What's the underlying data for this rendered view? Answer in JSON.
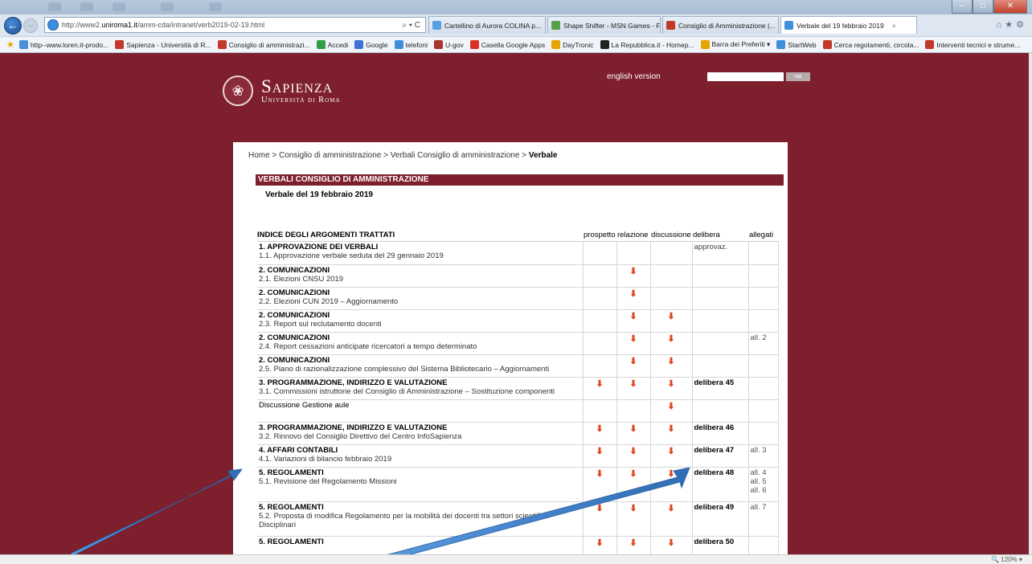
{
  "browser": {
    "url_prefix": "http://www2.",
    "url_domain": "uniroma1.it",
    "url_path": "/amm-cda/intranet/verb2019-02-19.html",
    "address_tools": "⌕ ▾ C",
    "tabs": [
      {
        "label": "Cartellino di Aurora COLINA p...",
        "color": "#58a0e0"
      },
      {
        "label": "Shape Shifter - MSN Games - F...",
        "color": "#56a24a"
      },
      {
        "label": "Consiglio di Amministrazione |...",
        "color": "#c0392b"
      },
      {
        "label": "Verbale del 19 febbraio 2019",
        "color": "#3f8fdd",
        "close": "×"
      }
    ],
    "favorites": [
      {
        "label": "http--www.loren.it-prodo...",
        "color": "#4a90d9"
      },
      {
        "label": "Sapienza - Università di R...",
        "color": "#c0392b"
      },
      {
        "label": "Consiglio di amministrazi...",
        "color": "#c0392b"
      },
      {
        "label": "Accedi",
        "color": "#2f9e44"
      },
      {
        "label": "Google",
        "color": "#3b73d6"
      },
      {
        "label": "telefoni",
        "color": "#3f8fdd"
      },
      {
        "label": "U-gov",
        "color": "#a8342b"
      },
      {
        "label": "Casella Google Apps",
        "color": "#d93025"
      },
      {
        "label": "DayTronic",
        "color": "#e6a500"
      },
      {
        "label": "La Repubblica.it - Homep...",
        "color": "#222222"
      },
      {
        "label": "Barra dei Preferiti ▾",
        "color": "#e6a500"
      },
      {
        "label": "StartWeb",
        "color": "#3f8fdd"
      },
      {
        "label": "Cerca regolamenti, circola...",
        "color": "#c0392b"
      },
      {
        "label": "Interventi tecnici e strume...",
        "color": "#c0392b"
      }
    ],
    "zoom": "120%"
  },
  "site": {
    "logo_title": "Sapienza",
    "logo_subtitle": "Università di Roma",
    "english_link": "english version",
    "search_placeholder": "",
    "search_button": "vai"
  },
  "breadcrumb": {
    "home": "Home",
    "sep": " > ",
    "level1": "Consiglio di amministrazione",
    "level2": "Verbali Consiglio di amministrazione",
    "current": "Verbale"
  },
  "section_title": "VERBALI CONSIGLIO DI AMMINISTRAZIONE",
  "verbale_date": "Verbale del  19 febbraio 2019",
  "table": {
    "headers": [
      "INDICE DEGLI ARGOMENTI TRATTATI",
      "prospetto",
      "relazione",
      "discussione",
      "delibera",
      "allegati"
    ],
    "rows": [
      {
        "title": "1. APPROVAZIONE DEI VERBALI",
        "sub": "1.1. Approvazione verbale seduta del 29 gennaio 2019",
        "p": false,
        "r": false,
        "d": false,
        "delibera": "approvaz.",
        "allegati": "",
        "h": "r1"
      },
      {
        "title": "2. COMUNICAZIONI",
        "sub": "2.1. Elezioni CNSU 2019",
        "p": false,
        "r": true,
        "d": false,
        "delibera": "",
        "allegati": "",
        "h": "r2"
      },
      {
        "title": "2. COMUNICAZIONI",
        "sub": "2.2. Elezioni CUN 2019 – Aggiornamento",
        "p": false,
        "r": true,
        "d": false,
        "delibera": "",
        "allegati": "",
        "h": "r2"
      },
      {
        "title": "2. COMUNICAZIONI",
        "sub": "2.3. Report sul reclutamento docenti",
        "p": false,
        "r": true,
        "d": true,
        "delibera": "",
        "allegati": "",
        "h": "r2"
      },
      {
        "title": "2. COMUNICAZIONI",
        "sub": "2.4. Report cessazioni anticipate ricercatori a tempo determinato",
        "p": false,
        "r": true,
        "d": true,
        "delibera": "",
        "allegati": "all. 2",
        "h": "r2"
      },
      {
        "title": "2. COMUNICAZIONI",
        "sub": "2.5. Piano di razionalizzazione complessivo del Sistema Bibliotecario – Aggiornamenti",
        "p": false,
        "r": true,
        "d": true,
        "delibera": "",
        "allegati": "",
        "h": "r2"
      },
      {
        "title": "3. PROGRAMMAZIONE, INDIRIZZO E VALUTAZIONE",
        "sub": "3.1. Commissioni istruttorie del Consiglio di Amministrazione – Sostituzione componenti",
        "p": true,
        "r": true,
        "d": true,
        "delibera": "delibera 45",
        "allegati": "",
        "h": "r2"
      },
      {
        "title": "",
        "sub": "Discussione Gestione aule",
        "p": false,
        "r": false,
        "d": true,
        "delibera": "",
        "allegati": "",
        "h": "r2",
        "plain": true
      },
      {
        "title": "3. PROGRAMMAZIONE, INDIRIZZO E VALUTAZIONE",
        "sub": "3.2. Rinnovo del Consiglio Direttivo del Centro InfoSapienza",
        "p": true,
        "r": true,
        "d": true,
        "delibera": "delibera 46",
        "allegati": "",
        "h": "r2"
      },
      {
        "title": "4. AFFARI CONTABILI",
        "sub": "4.1. Variazioni di bilancio febbraio 2019",
        "p": true,
        "r": true,
        "d": true,
        "delibera": "delibera 47",
        "allegati": "all. 3",
        "h": "r2"
      },
      {
        "title": "5. REGOLAMENTI",
        "sub": "5.1. Revisione del Regolamento Missioni",
        "p": true,
        "r": true,
        "d": true,
        "delibera": "delibera 48",
        "allegati": "all. 4\nall. 5\nall. 6",
        "h": "r3"
      },
      {
        "title": "5. REGOLAMENTI",
        "sub": "5.2. Proposta di modifica Regolamento per la mobilità dei docenti tra settori scientifico Disciplinari",
        "p": true,
        "r": true,
        "d": true,
        "delibera": "delibera 49",
        "allegati": "all. 7",
        "h": "r3"
      },
      {
        "title": "5. REGOLAMENTI",
        "sub": "",
        "p": true,
        "r": true,
        "d": true,
        "delibera": "delibera 50",
        "allegati": "",
        "h": "r2"
      }
    ]
  },
  "colors": {
    "brand": "#7e1f2d",
    "doc_icon": "#e0441b",
    "annotation_arrow": "#3d7cc9"
  }
}
